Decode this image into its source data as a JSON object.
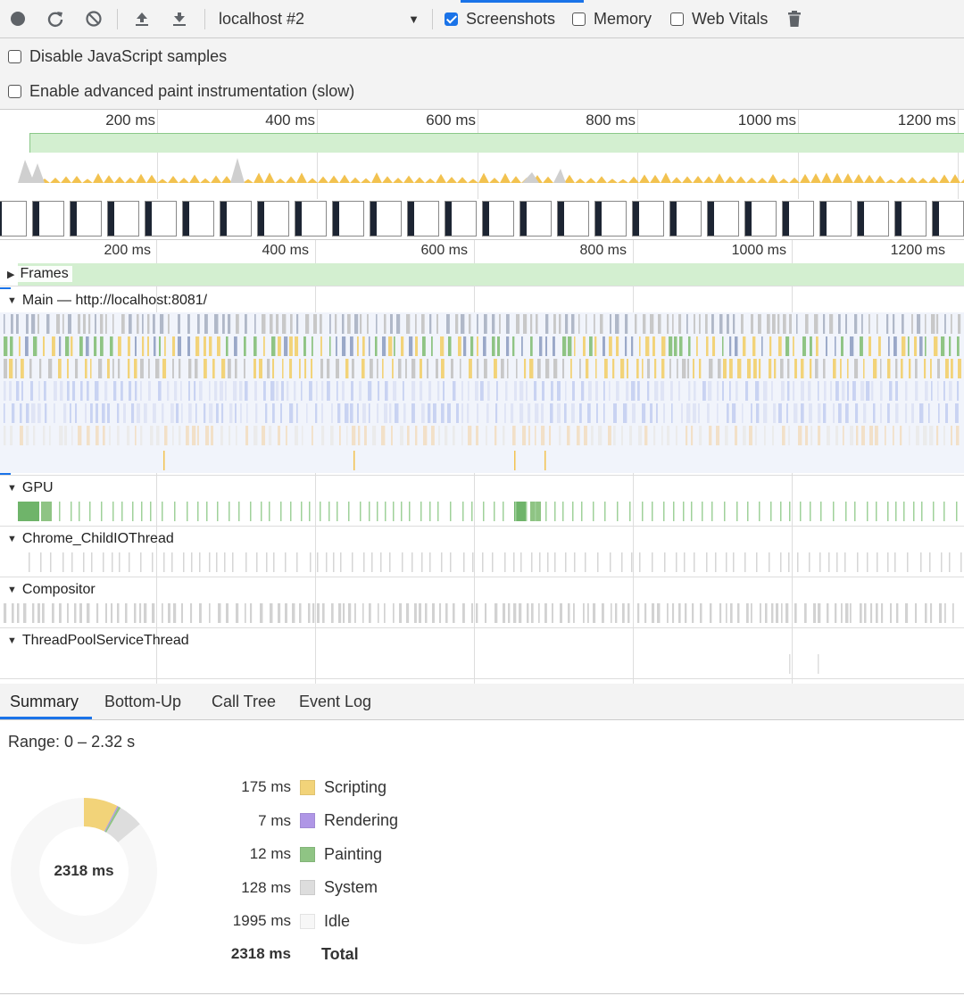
{
  "toolbar": {
    "record_icon": "record-icon",
    "reload_icon": "reload-icon",
    "clear_icon": "clear-icon",
    "upload_icon": "upload-icon",
    "download_icon": "download-icon",
    "target": "localhost #2",
    "screenshots_label": "Screenshots",
    "screenshots_checked": true,
    "memory_label": "Memory",
    "memory_checked": false,
    "web_vitals_label": "Web Vitals",
    "web_vitals_checked": false,
    "trash_icon": "trash-icon"
  },
  "settings": {
    "disable_js_samples": "Disable JavaScript samples",
    "advanced_paint": "Enable advanced paint instrumentation (slow)"
  },
  "overview": {
    "ticks": [
      "200 ms",
      "400 ms",
      "600 ms",
      "800 ms",
      "1000 ms",
      "1200 ms"
    ]
  },
  "flame": {
    "ticks": [
      "200 ms",
      "400 ms",
      "600 ms",
      "800 ms",
      "1000 ms",
      "1200 ms"
    ],
    "tracks": {
      "frames": "Frames",
      "main": "Main — http://localhost:8081/",
      "gpu": "GPU",
      "io": "Chrome_ChildIOThread",
      "compositor": "Compositor",
      "threadpool": "ThreadPoolServiceThread"
    }
  },
  "bottom": {
    "tabs": [
      "Summary",
      "Bottom-Up",
      "Call Tree",
      "Event Log"
    ],
    "active_tab": "Summary",
    "range": "Range: 0 – 2.32 s",
    "total_center": "2318 ms",
    "legend": [
      {
        "value": "175 ms",
        "name": "Scripting",
        "color": "#f2d379"
      },
      {
        "value": "7 ms",
        "name": "Rendering",
        "color": "#af96e6"
      },
      {
        "value": "12 ms",
        "name": "Painting",
        "color": "#8fc484"
      },
      {
        "value": "128 ms",
        "name": "System",
        "color": "#dddddd"
      },
      {
        "value": "1995 ms",
        "name": "Idle",
        "color": "#f7f7f7"
      }
    ],
    "total_value": "2318 ms",
    "total_label": "Total"
  }
}
